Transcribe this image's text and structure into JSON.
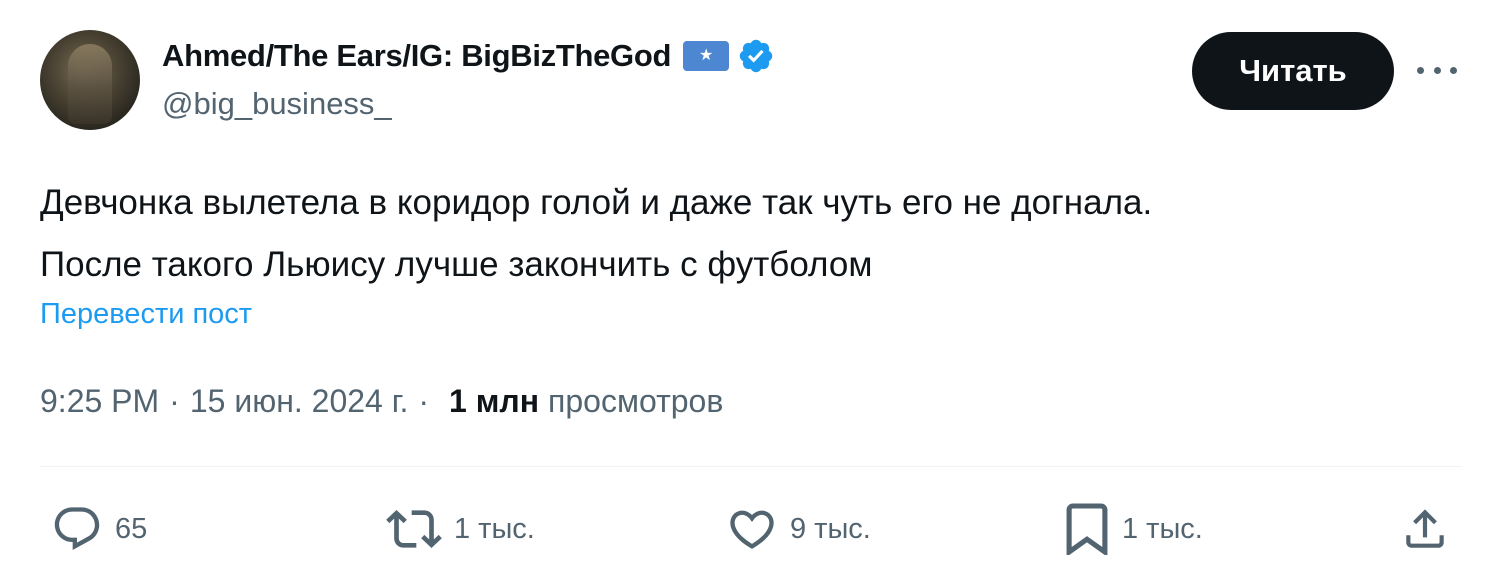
{
  "author": {
    "display_name": "Ahmed/The Ears/IG: BigBizTheGod",
    "flag_badge": "★",
    "handle": "@big_business_",
    "verified": true,
    "verified_color": "#1d9bf0"
  },
  "follow_button": {
    "label": "Читать"
  },
  "more_menu": {
    "icon": "more-horizontal-icon"
  },
  "tweet": {
    "lines": [
      "Девчонка вылетела в коридор голой и даже так чуть его не догнала.",
      "После такого Льюису лучше закончить с футболом"
    ],
    "translate_link": "Перевести пост"
  },
  "meta": {
    "time": "9:25 PM",
    "separator": "·",
    "date": "15 июн. 2024 г.",
    "views_count": "1 млн",
    "views_label": "просмотров"
  },
  "actions": {
    "reply": {
      "icon": "reply-icon",
      "count": "65"
    },
    "repost": {
      "icon": "repost-icon",
      "count": "1 тыс."
    },
    "like": {
      "icon": "heart-icon",
      "count": "9 тыс."
    },
    "bookmark": {
      "icon": "bookmark-icon",
      "count": "1 тыс."
    },
    "share": {
      "icon": "share-icon"
    }
  },
  "colors": {
    "text_primary": "#0f1419",
    "text_secondary": "#536471",
    "link": "#1d9bf0",
    "button_bg": "#0f1419",
    "flag_badge_bg": "#4d86d1"
  }
}
